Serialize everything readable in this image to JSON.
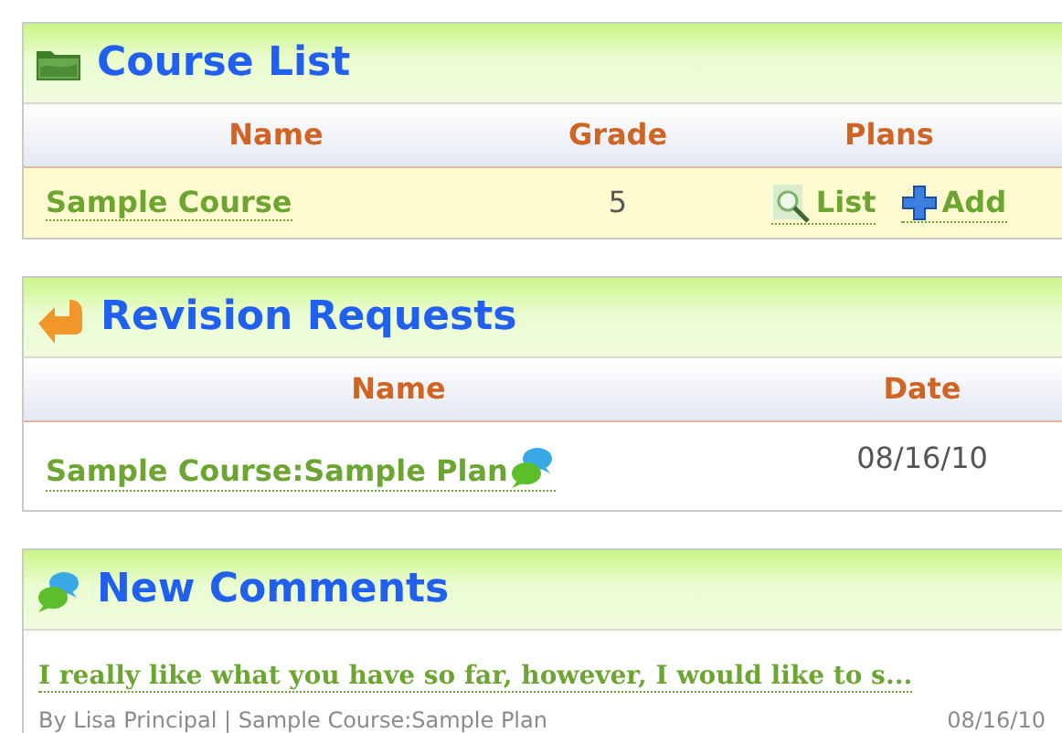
{
  "course_list": {
    "title": "Course List",
    "columns": [
      "Name",
      "Grade",
      "Plans"
    ],
    "rows": [
      {
        "name": "Sample Course",
        "grade": "5",
        "actions": [
          {
            "kind": "list",
            "label": "List"
          },
          {
            "kind": "add",
            "label": "Add"
          }
        ]
      }
    ]
  },
  "revision_requests": {
    "title": "Revision Requests",
    "columns": [
      "Name",
      "Date"
    ],
    "rows": [
      {
        "name": "Sample Course:Sample Plan",
        "date": "08/16/10"
      }
    ]
  },
  "new_comments": {
    "title": "New Comments",
    "items": [
      {
        "text": "I really like what you have so far, however, I would like to s...",
        "meta": "By Lisa Principal | Sample Course:Sample Plan",
        "date": "08/16/10"
      }
    ]
  }
}
